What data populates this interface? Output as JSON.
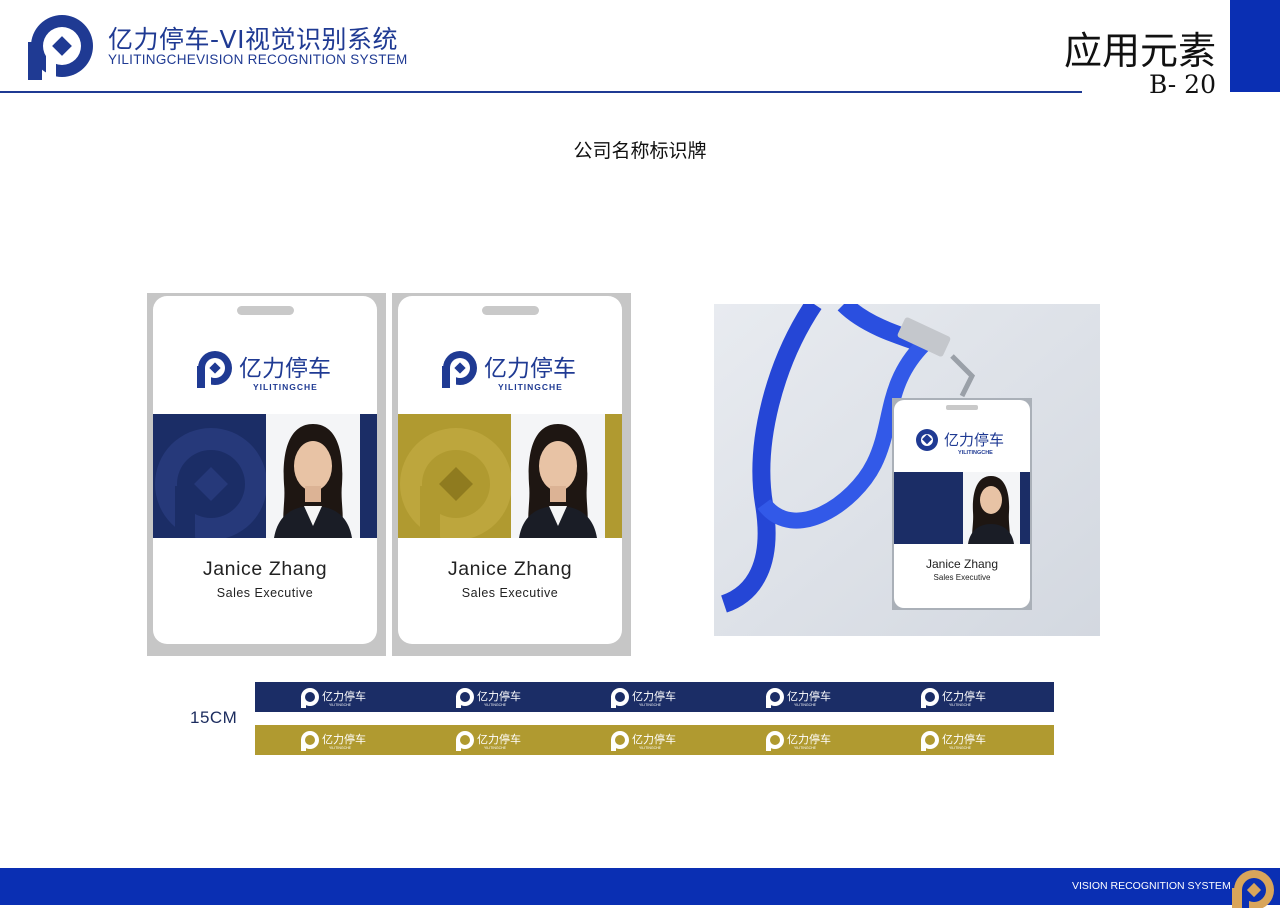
{
  "header": {
    "brand_title": "亿力停车-VI视觉识别系统",
    "brand_subtitle": "YILITINGCHEVISION RECOGNITION SYSTEM",
    "section_title": "应用元素",
    "page_code": "B- 20"
  },
  "page_heading": "公司名称标识牌",
  "brand": {
    "name_cn": "亿力停车",
    "name_en": "YILITINGCHE",
    "colors": {
      "blue": "#1f3a93",
      "navy": "#1b2d66",
      "gold": "#b09a30",
      "accent_blue": "#0a2fb3"
    }
  },
  "cards": [
    {
      "variant": "navy",
      "name": "Janice Zhang",
      "role": "Sales Executive"
    },
    {
      "variant": "gold",
      "name": "Janice Zhang",
      "role": "Sales Executive"
    }
  ],
  "lanyard_card": {
    "name": "Janice Zhang",
    "role": "Sales Executive"
  },
  "strip_label": "15CM",
  "strips": {
    "logo_count": 5,
    "variants": [
      "navy",
      "gold"
    ]
  },
  "footer": {
    "text": "VISION RECOGNITION SYSTEM"
  }
}
